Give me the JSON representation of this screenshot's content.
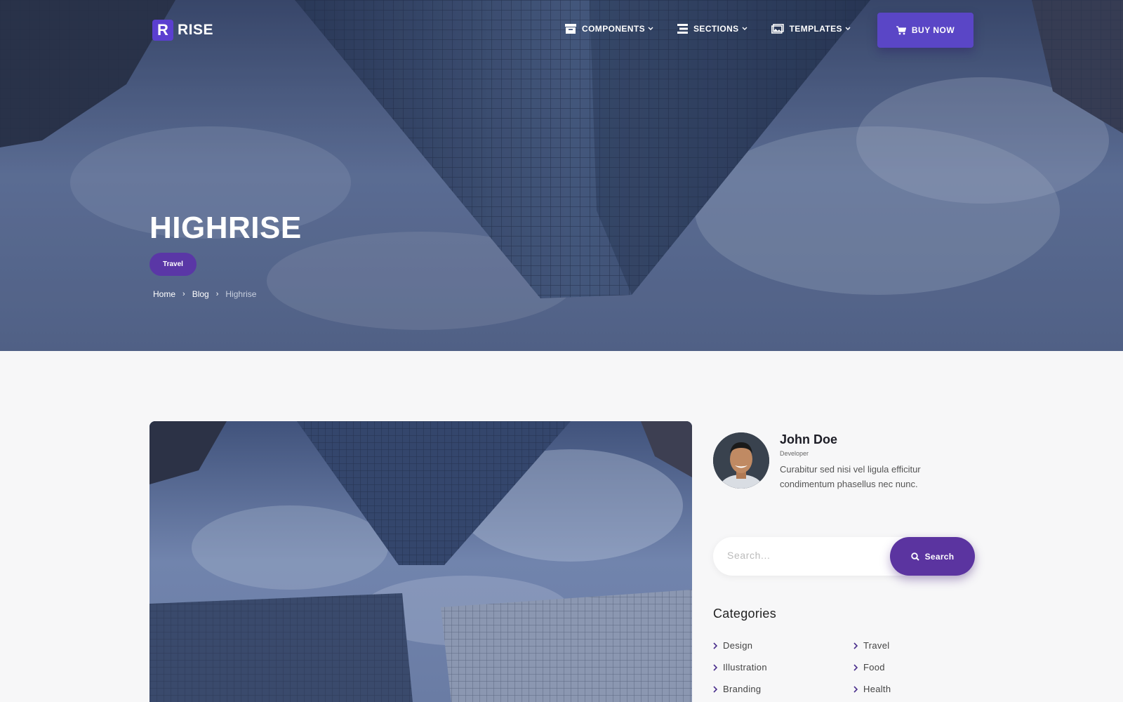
{
  "brand": {
    "mark": "R",
    "name": "RISE"
  },
  "nav": {
    "items": [
      {
        "label": "COMPONENTS",
        "icon": "archive-icon"
      },
      {
        "label": "SECTIONS",
        "icon": "list-icon"
      },
      {
        "label": "TEMPLATES",
        "icon": "image-icon"
      }
    ],
    "cta": {
      "label": "BUY NOW",
      "icon": "cart-icon"
    }
  },
  "hero": {
    "title": "HIGHRISE",
    "tag": "Travel",
    "breadcrumb": [
      "Home",
      "Blog",
      "Highrise"
    ]
  },
  "author": {
    "name": "John Doe",
    "role": "Developer",
    "bio": "Curabitur sed nisi vel ligula efficitur condimentum phasellus nec nunc."
  },
  "search": {
    "placeholder": "Search...",
    "button": "Search"
  },
  "categories": {
    "heading": "Categories",
    "items": [
      "Design",
      "Travel",
      "Illustration",
      "Food",
      "Branding",
      "Health"
    ]
  },
  "colors": {
    "accent": "#5b34a0",
    "button": "#5a46c6",
    "background": "#f7f7f8"
  }
}
